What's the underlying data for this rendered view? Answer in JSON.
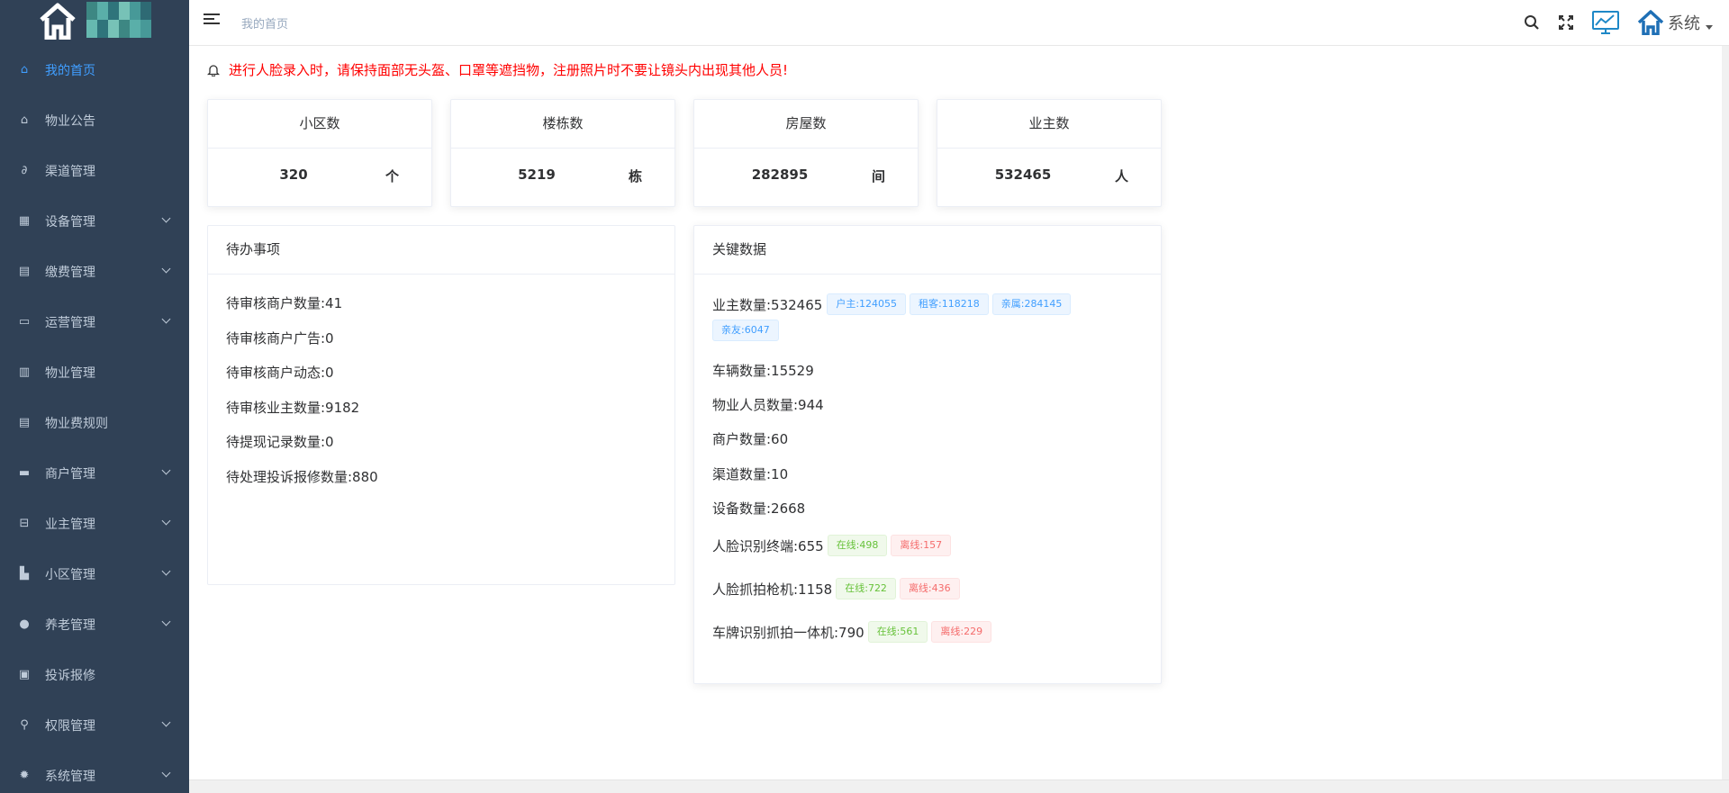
{
  "sidebar": {
    "items": [
      {
        "label": "我的首页",
        "icon": "home-icon",
        "active": true,
        "has_children": false
      },
      {
        "label": "物业公告",
        "icon": "notice-icon",
        "active": false,
        "has_children": false
      },
      {
        "label": "渠道管理",
        "icon": "link-icon",
        "active": false,
        "has_children": false
      },
      {
        "label": "设备管理",
        "icon": "grid-icon",
        "active": false,
        "has_children": true
      },
      {
        "label": "缴费管理",
        "icon": "document-icon",
        "active": false,
        "has_children": true
      },
      {
        "label": "运营管理",
        "icon": "monitor-icon",
        "active": false,
        "has_children": true
      },
      {
        "label": "物业管理",
        "icon": "building-icon",
        "active": false,
        "has_children": false
      },
      {
        "label": "物业费规则",
        "icon": "list-icon",
        "active": false,
        "has_children": false
      },
      {
        "label": "商户管理",
        "icon": "shop-icon",
        "active": false,
        "has_children": true
      },
      {
        "label": "业主管理",
        "icon": "car-icon",
        "active": false,
        "has_children": true
      },
      {
        "label": "小区管理",
        "icon": "community-icon",
        "active": false,
        "has_children": true
      },
      {
        "label": "养老管理",
        "icon": "user-icon",
        "active": false,
        "has_children": true
      },
      {
        "label": "投诉报修",
        "icon": "complaint-icon",
        "active": false,
        "has_children": false
      },
      {
        "label": "权限管理",
        "icon": "permission-icon",
        "active": false,
        "has_children": true
      },
      {
        "label": "系统管理",
        "icon": "gear-icon",
        "active": false,
        "has_children": true
      }
    ]
  },
  "header": {
    "breadcrumb": "我的首页",
    "system_label": "系统"
  },
  "notice": "进行人脸录入时，请保持面部无头盔、口罩等遮挡物，注册照片时不要让镜头内出现其他人员!",
  "stats": [
    {
      "title": "小区数",
      "value": "320",
      "unit": "个"
    },
    {
      "title": "楼栋数",
      "value": "5219",
      "unit": "栋"
    },
    {
      "title": "房屋数",
      "value": "282895",
      "unit": "间"
    },
    {
      "title": "业主数",
      "value": "532465",
      "unit": "人"
    }
  ],
  "todo": {
    "title": "待办事项",
    "items": [
      "待审核商户数量:41",
      "待审核商户广告:0",
      "待审核商户动态:0",
      "待审核业主数量:9182",
      "待提现记录数量:0",
      "待处理投诉报修数量:880"
    ]
  },
  "key": {
    "title": "关键数据",
    "owners": "业主数量:532465",
    "owner_tags": [
      "户主:124055",
      "租客:118218",
      "亲属:284145",
      "亲友:6047"
    ],
    "vehicles": "车辆数量:15529",
    "staff": "物业人员数量:944",
    "merchants": "商户数量:60",
    "channels": "渠道数量:10",
    "devices": "设备数量:2668",
    "face_terminal": "人脸识别终端:655",
    "face_terminal_online": "在线:498",
    "face_terminal_offline": "离线:157",
    "face_camera": "人脸抓拍枪机:1158",
    "face_camera_online": "在线:722",
    "face_camera_offline": "离线:436",
    "plate_camera": "车牌识别抓拍一体机:790",
    "plate_camera_online": "在线:561",
    "plate_camera_offline": "离线:229"
  },
  "colors": {
    "sidebar_bg": "#304156",
    "sidebar_text": "#bfcbd9",
    "active": "#409eff",
    "notice": "#ff0000"
  }
}
